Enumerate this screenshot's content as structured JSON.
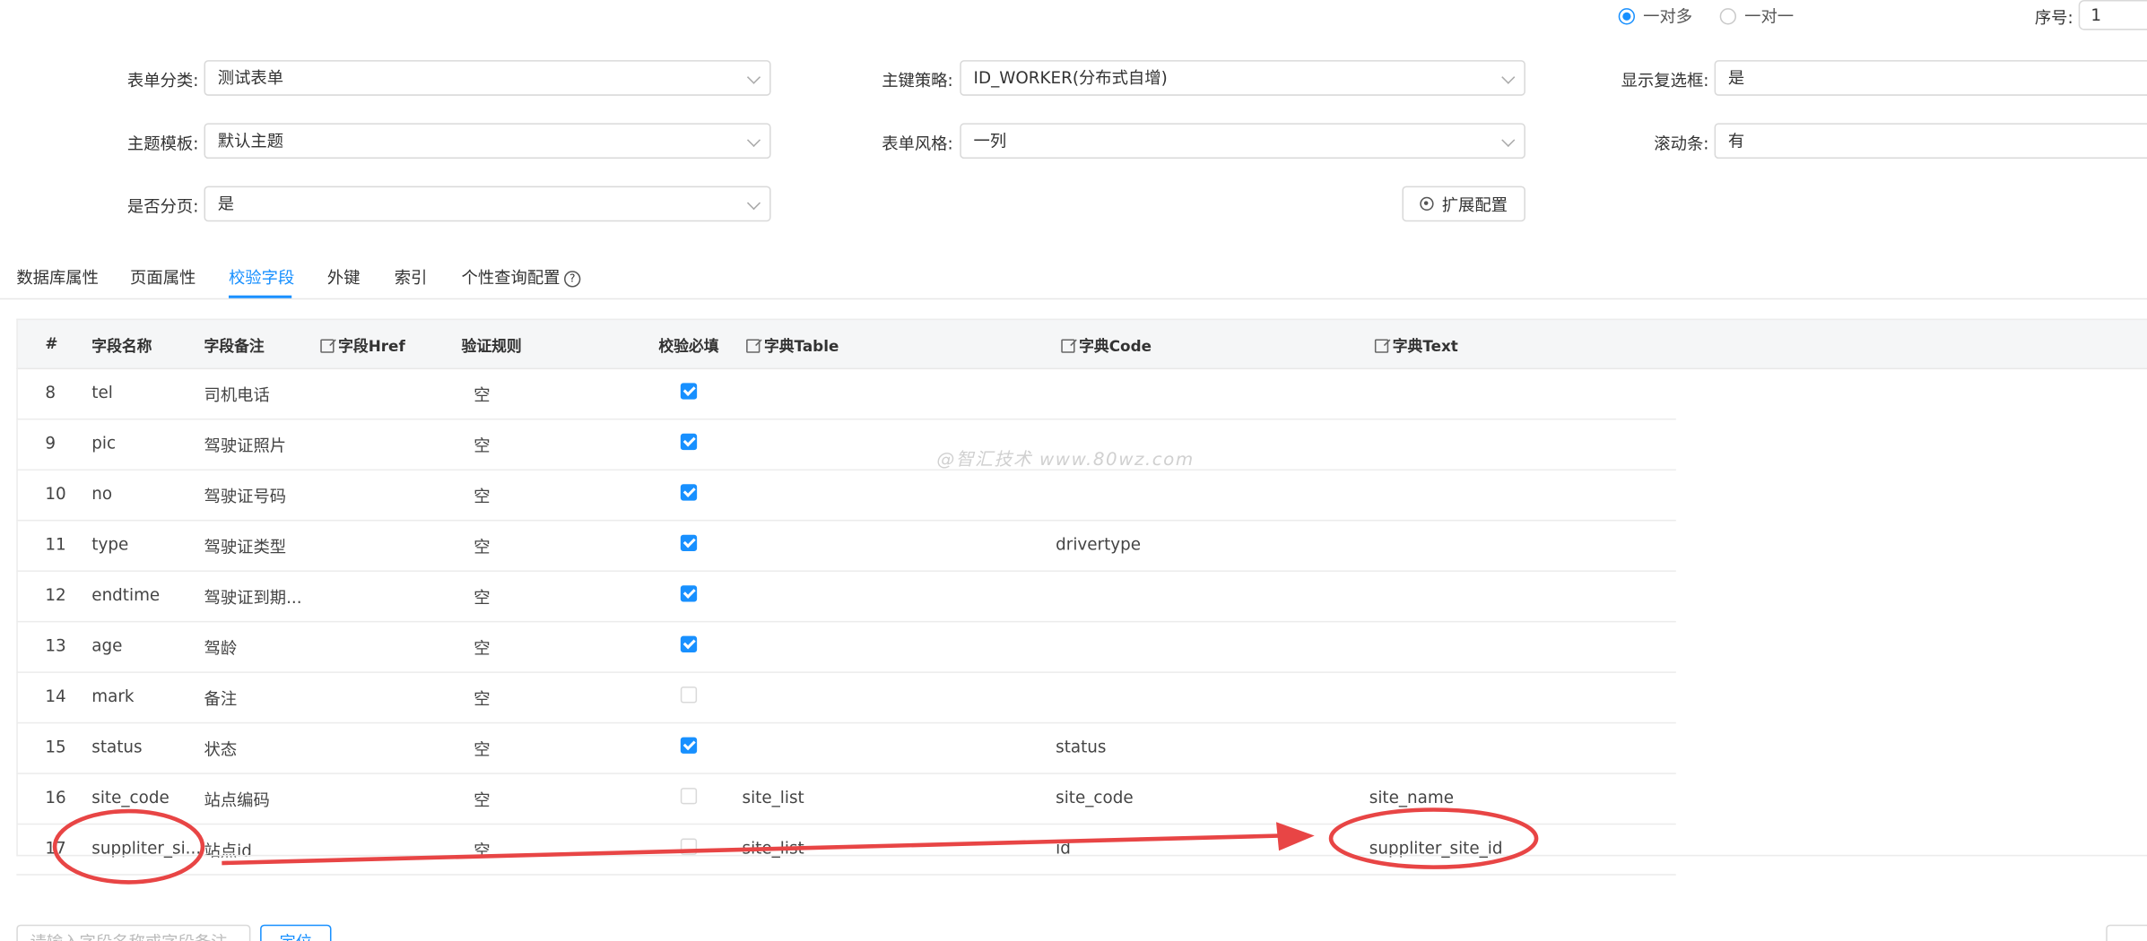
{
  "relation": {
    "options": [
      {
        "label": "一对多",
        "checked": true
      },
      {
        "label": "一对一",
        "checked": false
      }
    ]
  },
  "sequence": {
    "label": "序号:",
    "value": "1"
  },
  "form": {
    "category": {
      "label": "表单分类:",
      "value": "测试表单"
    },
    "pk_strategy": {
      "label": "主键策略:",
      "value": "ID_WORKER(分布式自增)"
    },
    "show_checkbox": {
      "label": "显示复选框:",
      "value": "是"
    },
    "theme": {
      "label": "主题模板:",
      "value": "默认主题"
    },
    "form_style": {
      "label": "表单风格:",
      "value": "一列"
    },
    "scrollbar": {
      "label": "滚动条:",
      "value": "有"
    },
    "paging": {
      "label": "是否分页:",
      "value": "是"
    },
    "ext_button": "扩展配置"
  },
  "tabs": [
    {
      "label": "数据库属性",
      "active": false
    },
    {
      "label": "页面属性",
      "active": false
    },
    {
      "label": "校验字段",
      "active": true
    },
    {
      "label": "外键",
      "active": false
    },
    {
      "label": "索引",
      "active": false
    },
    {
      "label": "个性查询配置",
      "active": false
    }
  ],
  "table": {
    "headers": {
      "idx": "#",
      "name": "字段名称",
      "remark": "字段备注",
      "href": "字段Href",
      "rule": "验证规则",
      "required": "校验必填",
      "dict_table": "字典Table",
      "dict_code": "字典Code",
      "dict_text": "字典Text"
    },
    "rows": [
      {
        "idx": "8",
        "name": "tel",
        "remark": "司机电话",
        "rule": "空",
        "required": true,
        "dict_table": "",
        "dict_code": "",
        "dict_text": ""
      },
      {
        "idx": "9",
        "name": "pic",
        "remark": "驾驶证照片",
        "rule": "空",
        "required": true,
        "dict_table": "",
        "dict_code": "",
        "dict_text": ""
      },
      {
        "idx": "10",
        "name": "no",
        "remark": "驾驶证号码",
        "rule": "空",
        "required": true,
        "dict_table": "",
        "dict_code": "",
        "dict_text": ""
      },
      {
        "idx": "11",
        "name": "type",
        "remark": "驾驶证类型",
        "rule": "空",
        "required": true,
        "dict_table": "",
        "dict_code": "drivertype",
        "dict_text": ""
      },
      {
        "idx": "12",
        "name": "endtime",
        "remark": "驾驶证到期...",
        "rule": "空",
        "required": true,
        "dict_table": "",
        "dict_code": "",
        "dict_text": ""
      },
      {
        "idx": "13",
        "name": "age",
        "remark": "驾龄",
        "rule": "空",
        "required": true,
        "dict_table": "",
        "dict_code": "",
        "dict_text": ""
      },
      {
        "idx": "14",
        "name": "mark",
        "remark": "备注",
        "rule": "空",
        "required": false,
        "dict_table": "",
        "dict_code": "",
        "dict_text": ""
      },
      {
        "idx": "15",
        "name": "status",
        "remark": "状态",
        "rule": "空",
        "required": true,
        "dict_table": "",
        "dict_code": "status",
        "dict_text": ""
      },
      {
        "idx": "16",
        "name": "site_code",
        "remark": "站点编码",
        "rule": "空",
        "required": false,
        "dict_table": "site_list",
        "dict_code": "site_code",
        "dict_text": "site_name"
      },
      {
        "idx": "17",
        "name": "suppliter_si...",
        "remark": "站点id",
        "rule": "空",
        "required": false,
        "dict_table": "site_list",
        "dict_code": "id",
        "dict_text": "suppliter_site_id"
      }
    ]
  },
  "watermark": "@智汇技术 www.80wz.com",
  "bottom": {
    "search_placeholder": "请输入字段名称或字段备注",
    "locate_button": "定位"
  },
  "colors": {
    "accent": "#1890ff",
    "annotation": "#e84545"
  }
}
